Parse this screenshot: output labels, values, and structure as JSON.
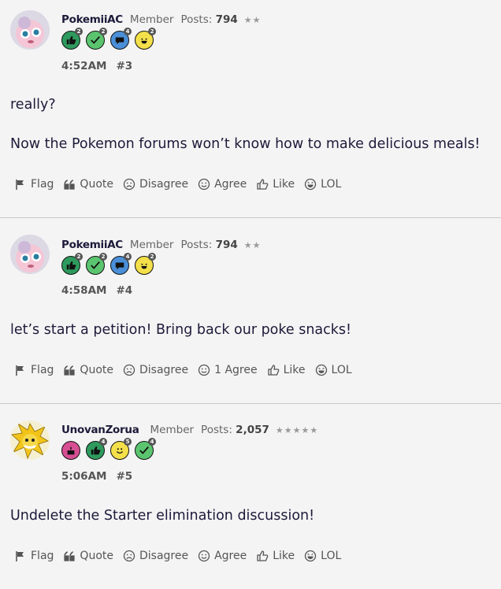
{
  "posts": [
    {
      "user": "PokemiiAC",
      "role": "Member",
      "posts_label": "Posts:",
      "posts_count": "794",
      "stars": "★★",
      "avatar": "jigglypuff-avatar",
      "badges": [
        {
          "icon": "thumbs-up-icon",
          "color": "#2e9a5d",
          "num": "2"
        },
        {
          "icon": "check-icon",
          "color": "#5bc46f",
          "num": "2"
        },
        {
          "icon": "speech-bubble-icon",
          "color": "#4a8fd8",
          "num": "4"
        },
        {
          "icon": "laughing-face-icon",
          "color": "#f3e04a",
          "num": "2"
        }
      ],
      "time": "4:52AM",
      "number": "#3",
      "paragraphs": [
        "really?",
        "Now the Pokemon forums won’t know how to make delicious meals!"
      ],
      "actions": {
        "flag": "Flag",
        "quote": "Quote",
        "disagree": "Disagree",
        "agree": "Agree",
        "like": "Like",
        "lol": "LOL"
      }
    },
    {
      "user": "PokemiiAC",
      "role": "Member",
      "posts_label": "Posts:",
      "posts_count": "794",
      "stars": "★★",
      "avatar": "jigglypuff-avatar",
      "badges": [
        {
          "icon": "thumbs-up-icon",
          "color": "#2e9a5d",
          "num": "2"
        },
        {
          "icon": "check-icon",
          "color": "#5bc46f",
          "num": "2"
        },
        {
          "icon": "speech-bubble-icon",
          "color": "#4a8fd8",
          "num": "4"
        },
        {
          "icon": "laughing-face-icon",
          "color": "#f3e04a",
          "num": "2"
        }
      ],
      "time": "4:58AM",
      "number": "#4",
      "paragraphs": [
        "let’s start a petition! Bring back our poke snacks!"
      ],
      "actions": {
        "flag": "Flag",
        "quote": "Quote",
        "disagree": "Disagree",
        "agree": "1 Agree",
        "like": "Like",
        "lol": "LOL"
      }
    },
    {
      "user": "UnovanZorua",
      "role": "Member",
      "posts_label": "Posts:",
      "posts_count": "2,057",
      "stars": "★★★★★",
      "avatar": "jolteon-avatar",
      "badges": [
        {
          "icon": "cake-icon",
          "color": "#d64f92",
          "num": ""
        },
        {
          "icon": "thumbs-up-icon",
          "color": "#2e9a5d",
          "num": "4"
        },
        {
          "icon": "smile-face-icon",
          "color": "#f3e04a",
          "num": "5"
        },
        {
          "icon": "check-icon",
          "color": "#5bc46f",
          "num": "4"
        }
      ],
      "time": "5:06AM",
      "number": "#5",
      "paragraphs": [
        "Undelete the Starter elimination discussion!"
      ],
      "actions": {
        "flag": "Flag",
        "quote": "Quote",
        "disagree": "Disagree",
        "agree": "Agree",
        "like": "Like",
        "lol": "LOL"
      }
    }
  ]
}
